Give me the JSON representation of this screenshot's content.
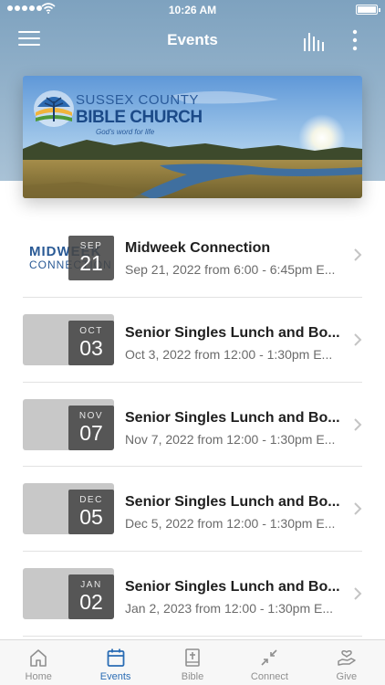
{
  "status_bar": {
    "time": "10:26 AM"
  },
  "nav": {
    "title": "Events"
  },
  "banner": {
    "logo_line1": "SUSSEX COUNTY",
    "logo_line2": "BIBLE CHURCH",
    "logo_tagline": "God's word for life"
  },
  "events": [
    {
      "title": "Midweek Connection",
      "subtitle": "Sep 21, 2022 from 6:00 - 6:45pm E...",
      "month": "SEP",
      "day": "21",
      "thumb_line1": "MIDWEEK",
      "thumb_line2": "CONNECTION"
    },
    {
      "title": "Senior Singles Lunch and Bo...",
      "subtitle": "Oct 3, 2022 from 12:00 - 1:30pm E...",
      "month": "OCT",
      "day": "03"
    },
    {
      "title": "Senior Singles Lunch and Bo...",
      "subtitle": "Nov 7, 2022 from 12:00 - 1:30pm E...",
      "month": "NOV",
      "day": "07"
    },
    {
      "title": "Senior Singles Lunch and Bo...",
      "subtitle": "Dec 5, 2022 from 12:00 - 1:30pm E...",
      "month": "DEC",
      "day": "05"
    },
    {
      "title": "Senior Singles Lunch and Bo...",
      "subtitle": "Jan 2, 2023 from 12:00 - 1:30pm E...",
      "month": "JAN",
      "day": "02"
    }
  ],
  "tabs": [
    {
      "label": "Home",
      "icon": "home-icon"
    },
    {
      "label": "Events",
      "icon": "calendar-icon",
      "active": true
    },
    {
      "label": "Bible",
      "icon": "bible-icon"
    },
    {
      "label": "Connect",
      "icon": "connect-icon"
    },
    {
      "label": "Give",
      "icon": "give-icon"
    }
  ],
  "colors": {
    "header": "#7ea2bf",
    "accent": "#2a6cb4",
    "tab_inactive": "#8f8f8f"
  }
}
